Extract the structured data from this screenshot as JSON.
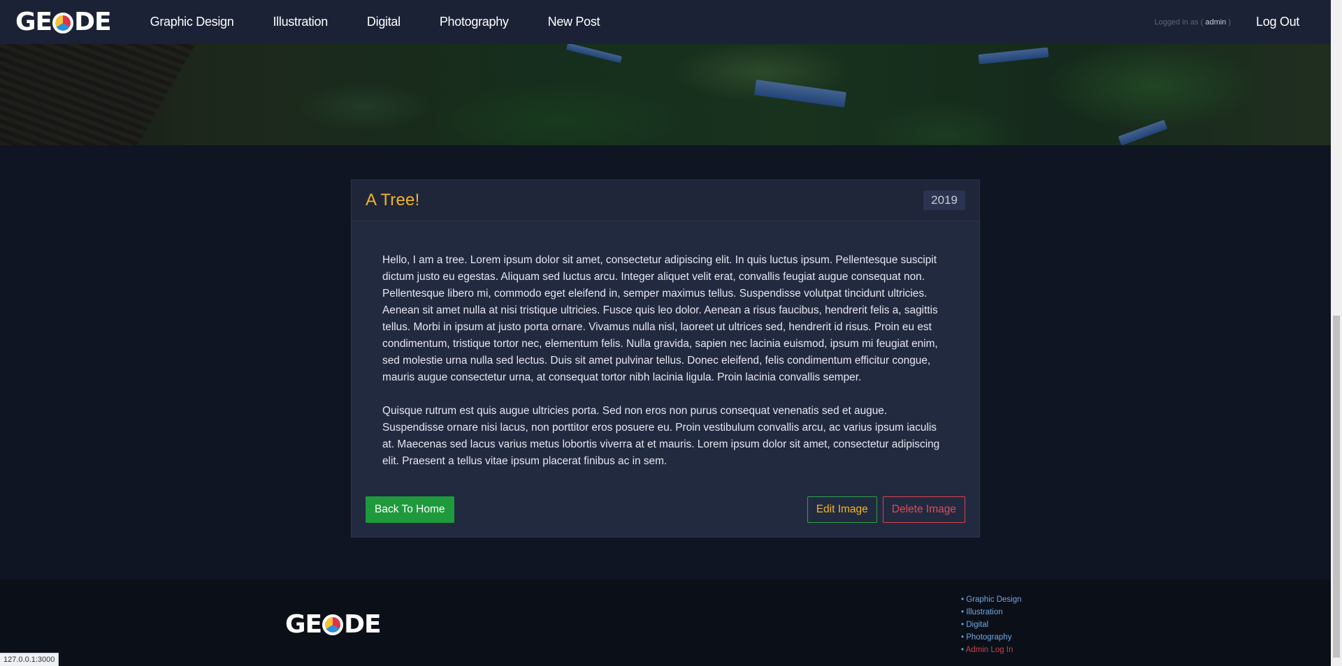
{
  "brand": {
    "logo_text_left": "GE",
    "logo_text_right": "DE"
  },
  "nav": {
    "links": [
      "Graphic Design",
      "Illustration",
      "Digital",
      "Photography",
      "New Post"
    ],
    "logged_in_prefix": "Logged in as (",
    "username": "admin",
    "logged_in_suffix": ")",
    "logout_label": "Log Out"
  },
  "post": {
    "title": "A Tree!",
    "year": "2019",
    "paragraphs": [
      "Hello, I am a tree. Lorem ipsum dolor sit amet, consectetur adipiscing elit. In quis luctus ipsum. Pellentesque suscipit dictum justo eu egestas. Aliquam sed luctus arcu. Integer aliquet velit erat, convallis feugiat augue consequat non. Pellentesque libero mi, commodo eget eleifend in, semper maximus tellus. Suspendisse volutpat tincidunt ultricies. Aenean sit amet nulla at nisi tristique ultricies. Fusce quis leo dolor. Aenean a risus faucibus, hendrerit felis a, sagittis tellus. Morbi in ipsum at justo porta ornare. Vivamus nulla nisl, laoreet ut ultrices sed, hendrerit id risus. Proin eu est condimentum, tristique tortor nec, elementum felis. Nulla gravida, sapien nec lacinia euismod, ipsum mi feugiat enim, sed molestie urna nulla sed lectus. Duis sit amet pulvinar tellus. Donec eleifend, felis condimentum efficitur congue, mauris augue consectetur urna, at consequat tortor nibh lacinia ligula. Proin lacinia convallis semper.",
      "Quisque rutrum est quis augue ultricies porta. Sed non eros non purus consequat venenatis sed et augue. Suspendisse ornare nisi lacus, non porttitor eros posuere eu. Proin vestibulum convallis arcu, ac varius ipsum iaculis at. Maecenas sed lacus varius metus lobortis viverra at et mauris. Lorem ipsum dolor sit amet, consectetur adipiscing elit. Praesent a tellus vitae ipsum placerat finibus ac in sem."
    ],
    "back_label": "Back To Home",
    "edit_label": "Edit Image",
    "delete_label": "Delete Image"
  },
  "footer": {
    "links": [
      "Graphic Design",
      "Illustration",
      "Digital",
      "Photography"
    ],
    "admin_label": "Admin Log In"
  },
  "status_url": "127.0.0.1:3000",
  "colors": {
    "accent": "#f0b429",
    "success": "#1e9a3c",
    "danger": "#d9434f",
    "link": "#6fa8e0"
  }
}
